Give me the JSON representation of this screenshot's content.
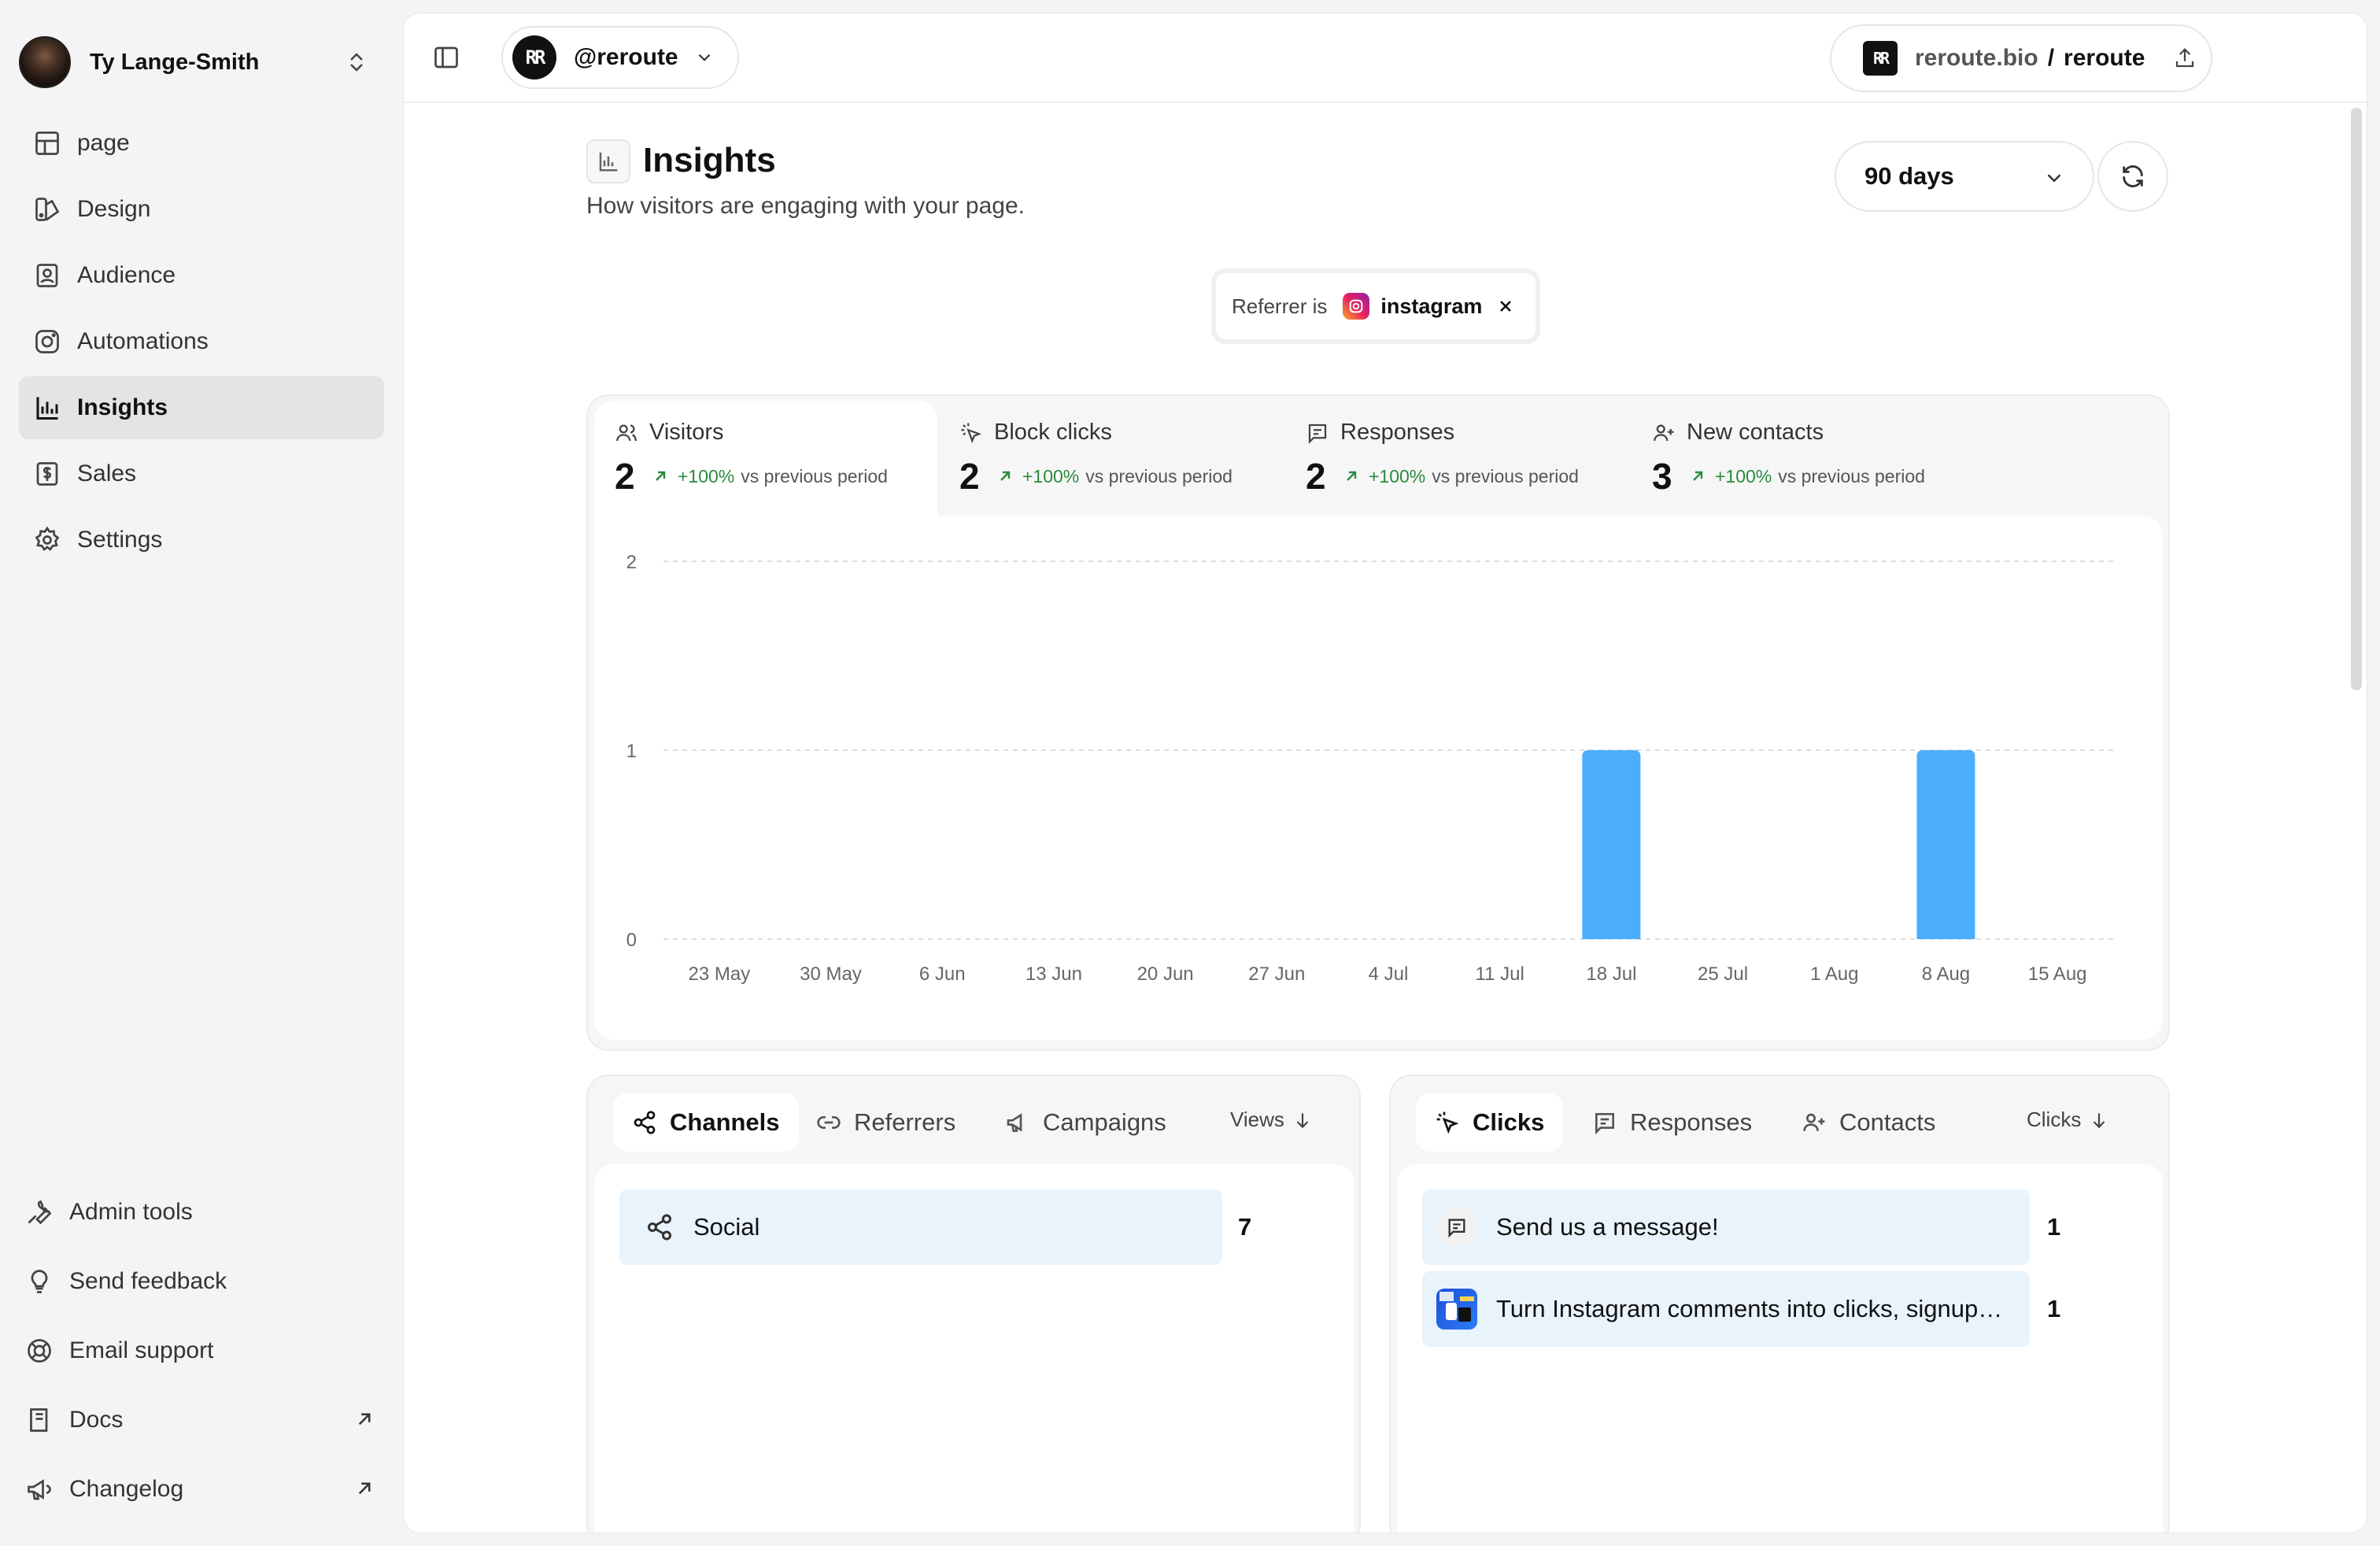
{
  "workspace": {
    "user_name": "Ty Lange-Smith"
  },
  "sidebar": {
    "items": [
      {
        "label": "page",
        "icon": "layout-icon",
        "active": false
      },
      {
        "label": "Design",
        "icon": "palette-icon",
        "active": false
      },
      {
        "label": "Audience",
        "icon": "contact-book-icon",
        "active": false
      },
      {
        "label": "Automations",
        "icon": "instagram-icon",
        "active": false
      },
      {
        "label": "Insights",
        "icon": "bar-chart-icon",
        "active": true
      },
      {
        "label": "Sales",
        "icon": "dollar-receipt-icon",
        "active": false
      },
      {
        "label": "Settings",
        "icon": "gear-icon",
        "active": false
      }
    ],
    "bottom": [
      {
        "label": "Admin tools",
        "icon": "wrench-icon"
      },
      {
        "label": "Send feedback",
        "icon": "lightbulb-icon"
      },
      {
        "label": "Email support",
        "icon": "lifebuoy-icon"
      },
      {
        "label": "Docs",
        "icon": "book-icon",
        "external": true
      },
      {
        "label": "Changelog",
        "icon": "megaphone-icon",
        "external": true
      }
    ]
  },
  "topbar": {
    "account": "@reroute",
    "logo_text": "RR",
    "url_host": "reroute.bio",
    "url_sep": "/",
    "url_slug": "reroute"
  },
  "header": {
    "title": "Insights",
    "subtitle": "How visitors are engaging with your page.",
    "range": "90 days"
  },
  "filter": {
    "label": "Referrer is",
    "value": "instagram"
  },
  "metrics": [
    {
      "label": "Visitors",
      "value": "2",
      "delta": "+100%",
      "compare": "vs previous period",
      "icon": "users-icon",
      "active": true
    },
    {
      "label": "Block clicks",
      "value": "2",
      "delta": "+100%",
      "compare": "vs previous period",
      "icon": "click-icon",
      "active": false
    },
    {
      "label": "Responses",
      "value": "2",
      "delta": "+100%",
      "compare": "vs previous period",
      "icon": "message-icon",
      "active": false
    },
    {
      "label": "New contacts",
      "value": "3",
      "delta": "+100%",
      "compare": "vs previous period",
      "icon": "user-plus-icon",
      "active": false
    }
  ],
  "colors": {
    "bar": "#4aaefc",
    "positive": "#2a8a3e",
    "row_highlight": "#e8f3fc"
  },
  "chart_data": {
    "type": "bar",
    "categories": [
      "23 May",
      "30 May",
      "6 Jun",
      "13 Jun",
      "20 Jun",
      "27 Jun",
      "4 Jul",
      "11 Jul",
      "18 Jul",
      "25 Jul",
      "1 Aug",
      "8 Aug",
      "15 Aug"
    ],
    "series": [
      {
        "values": [
          0,
          0,
          0,
          0,
          0,
          0,
          0,
          0,
          1,
          0,
          0,
          1,
          0
        ]
      }
    ],
    "yticks": [
      "0",
      "1",
      "2"
    ],
    "ylim": [
      0,
      2
    ],
    "grid": true
  },
  "channels_panel": {
    "tabs": [
      "Channels",
      "Referrers",
      "Campaigns"
    ],
    "sort_label": "Views",
    "rows": [
      {
        "label": "Social",
        "value": "7"
      }
    ]
  },
  "clicks_panel": {
    "tabs": [
      "Clicks",
      "Responses",
      "Contacts"
    ],
    "sort_label": "Clicks",
    "rows": [
      {
        "label": "Send us a message!",
        "value": "1"
      },
      {
        "label": "Turn Instagram comments into clicks, signup…",
        "value": "1"
      }
    ]
  }
}
